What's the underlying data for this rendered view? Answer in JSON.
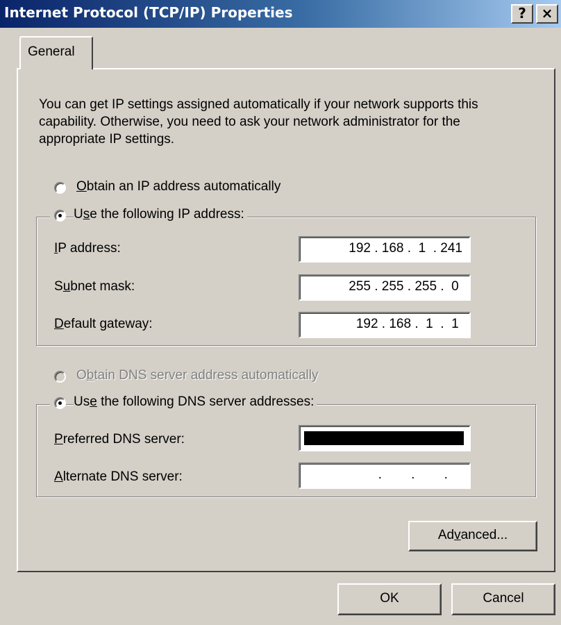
{
  "window": {
    "title": "Internet Protocol (TCP/IP) Properties",
    "help_label": "?",
    "close_label": "×"
  },
  "tabs": [
    {
      "label": "General"
    }
  ],
  "intro_text": "You can get IP settings assigned automatically if your network supports this capability. Otherwise, you need to ask your network administrator for the appropriate IP settings.",
  "ip": {
    "auto_option": {
      "pre": "",
      "mnemonic": "O",
      "post": "btain an IP address automatically",
      "selected": false
    },
    "manual_option": {
      "pre": "U",
      "mnemonic": "s",
      "post": "e the following IP address:",
      "selected": true
    },
    "fields": [
      {
        "pre": "",
        "mnemonic": "I",
        "post": "P address:",
        "value": "192 . 168 .  1  . 241"
      },
      {
        "pre": "S",
        "mnemonic": "u",
        "post": "bnet mask:",
        "value": "255 . 255 . 255 .  0 "
      },
      {
        "pre": "",
        "mnemonic": "D",
        "post": "efault gateway:",
        "value": "192 . 168 .  1  .  1 "
      }
    ]
  },
  "dns": {
    "auto_option": {
      "pre": "O",
      "mnemonic": "b",
      "post": "tain DNS server address automatically",
      "selected": false,
      "disabled": true
    },
    "manual_option": {
      "pre": "Us",
      "mnemonic": "e",
      "post": " the following DNS server addresses:",
      "selected": true
    },
    "fields": [
      {
        "pre": "",
        "mnemonic": "P",
        "post": "referred DNS server:",
        "value": "",
        "redacted": true
      },
      {
        "pre": "",
        "mnemonic": "A",
        "post": "lternate DNS server:",
        "value": ".        .        .    ",
        "redacted": false
      }
    ]
  },
  "buttons": {
    "advanced": {
      "pre": "Ad",
      "mnemonic": "v",
      "post": "anced..."
    },
    "ok": "OK",
    "cancel": "Cancel"
  },
  "colors": {
    "title_gradient_start": "#0a246a",
    "title_gradient_end": "#a6caf0",
    "face": "#d4d0c8"
  }
}
